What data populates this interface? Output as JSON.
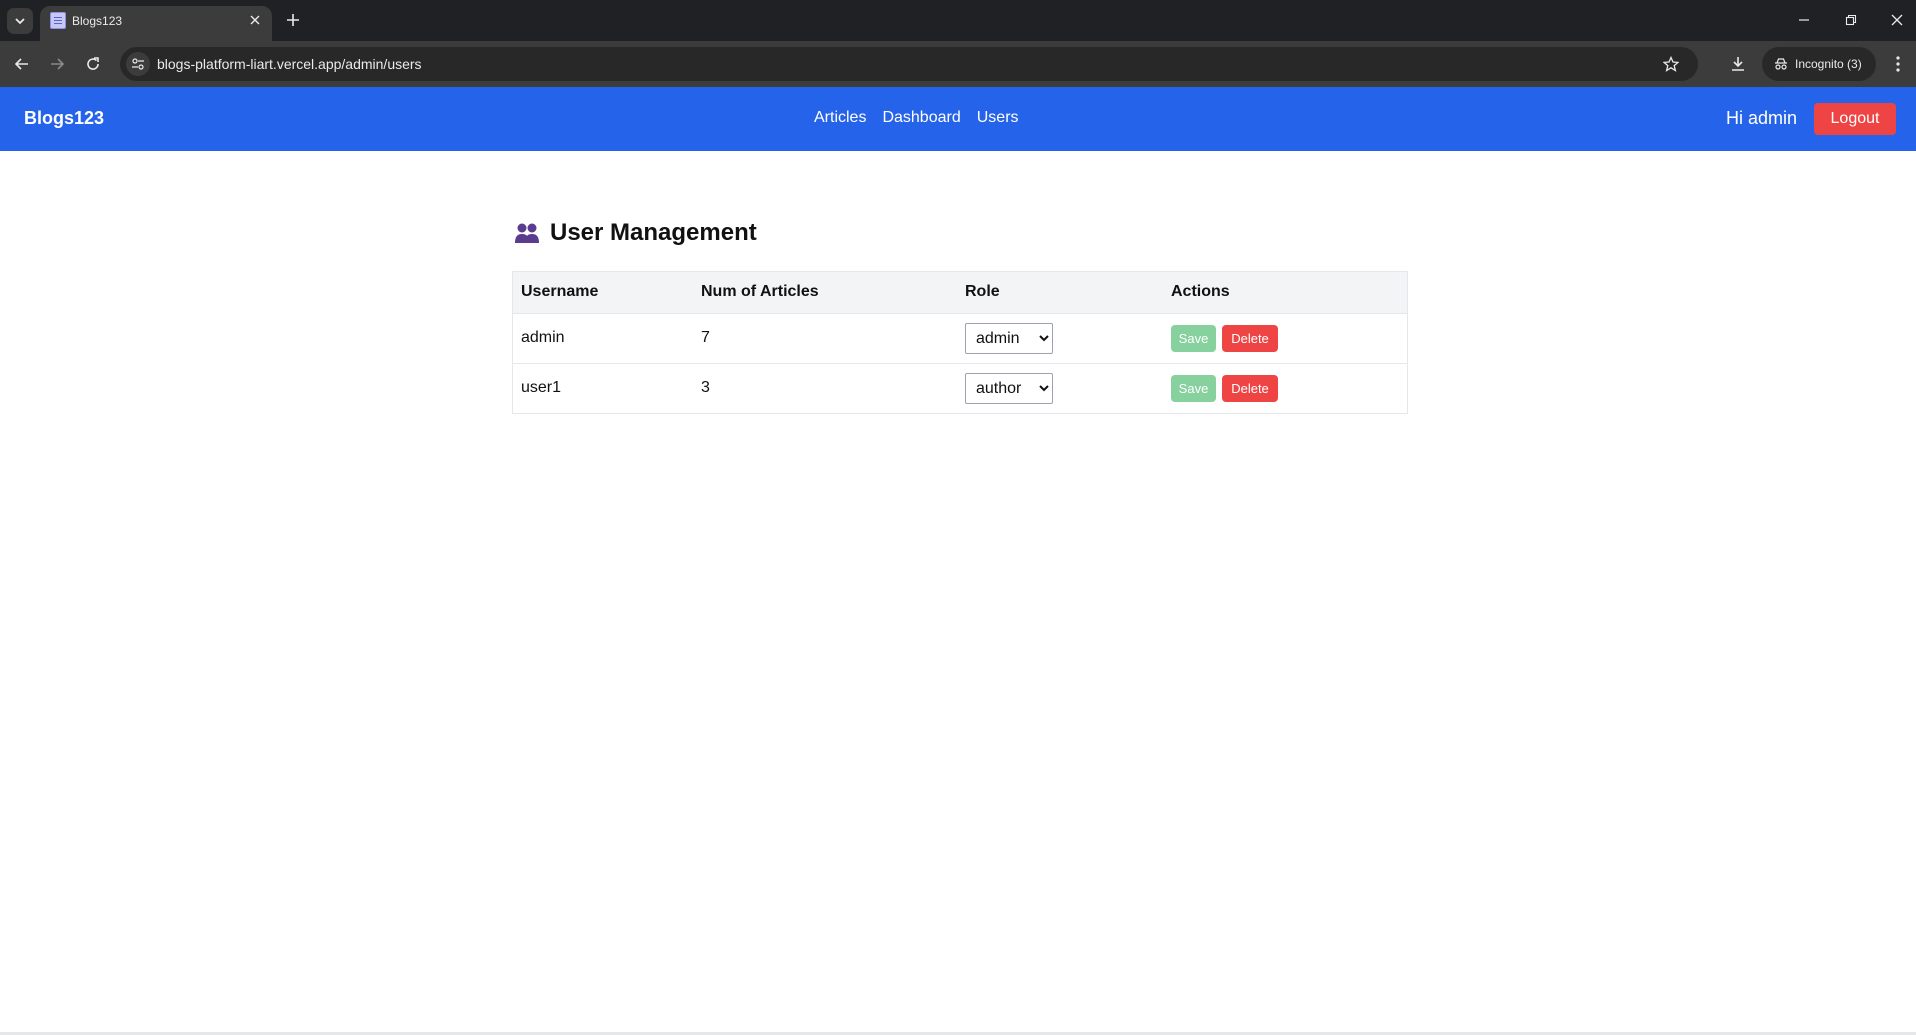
{
  "browser": {
    "tab_title": "Blogs123",
    "url": "blogs-platform-liart.vercel.app/admin/users",
    "incognito_label": "Incognito (3)"
  },
  "navbar": {
    "brand": "Blogs123",
    "links": [
      "Articles",
      "Dashboard",
      "Users"
    ],
    "greeting": "Hi admin",
    "logout_label": "Logout",
    "bg_color": "#2563eb"
  },
  "page": {
    "title": "User Management"
  },
  "table": {
    "columns": [
      "Username",
      "Num of Articles",
      "Role",
      "Actions"
    ],
    "rows": [
      {
        "username": "admin",
        "num_articles": "7",
        "role": "admin"
      },
      {
        "username": "user1",
        "num_articles": "3",
        "role": "author"
      }
    ],
    "save_label": "Save",
    "delete_label": "Delete"
  }
}
